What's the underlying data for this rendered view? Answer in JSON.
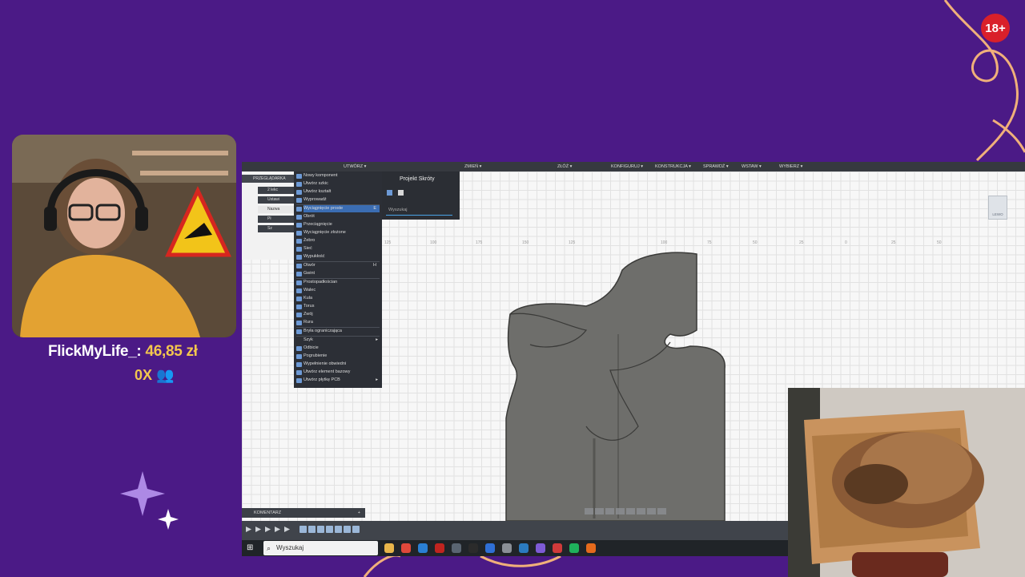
{
  "overlay": {
    "donor_name": "FlickMyLife_:",
    "donor_amount": "46,85 zł",
    "counter": "0X",
    "age_badge": "18+",
    "icons": [
      "webcam-feed",
      "people-icon",
      "sparkle-icon",
      "cat-camera-feed"
    ]
  },
  "app": {
    "toolbar": [
      "UTWÓRZ ▾",
      "ZMIEŃ ▾",
      "ZŁÓŻ ▾",
      "KONFIGURUJ ▾",
      "KONSTRUKCJA ▾",
      "SPRAWDŹ ▾",
      "WSTAW ▾",
      "WYBIERZ ▾"
    ],
    "browser": {
      "title": "PRZEGLĄDARKA",
      "rows": [
        "2 lekc",
        "Ustawi",
        "Nazwa",
        "Pł",
        "Sz"
      ]
    },
    "create_menu": [
      "Nowy komponent",
      "Utwórz szkic",
      "Utwórz kształt",
      "Wyprowadź",
      "Wyciągnięcie proste",
      "Obrót",
      "Przeciągnięcie",
      "Wyciągnięcie złożone",
      "Żebro",
      "Sieć",
      "Wypukłość",
      "Otwór",
      "Gwint",
      "Prostopadłościan",
      "Walec",
      "Kula",
      "Torus",
      "Zwój",
      "Rura",
      "Bryła ograniczająca",
      "Szyk",
      "Odbicie",
      "Pogrubienie",
      "Wypełnienie obwiedni",
      "Utwórz element bazowy",
      "Utwórz płytkę PCB"
    ],
    "shortcut_keys": {
      "Wyciągnięcie proste": "E",
      "Otwór": "H"
    },
    "shortcuts_panel": {
      "title": "Projekt Skróty",
      "search_placeholder": "Wyszukaj"
    },
    "view_cube_label": "LEWO",
    "comment_label": "KOMENTARZ",
    "comment_add": "+",
    "ruler_ticks": [
      "125",
      "100",
      "175",
      "150",
      "125",
      "100",
      "75",
      "50",
      "25",
      "0",
      "25",
      "50"
    ]
  },
  "taskbar": {
    "search_placeholder": "Wyszukaj",
    "app_colors": [
      "#e8b54a",
      "#e0483b",
      "#2a7fd3",
      "#c0241f",
      "#5a6572",
      "#2b2b2b",
      "#2f6fd6",
      "#8a8f96",
      "#2b7bbf",
      "#7e5bd6",
      "#d03a3a",
      "#1fb15c",
      "#e56a1c"
    ]
  }
}
